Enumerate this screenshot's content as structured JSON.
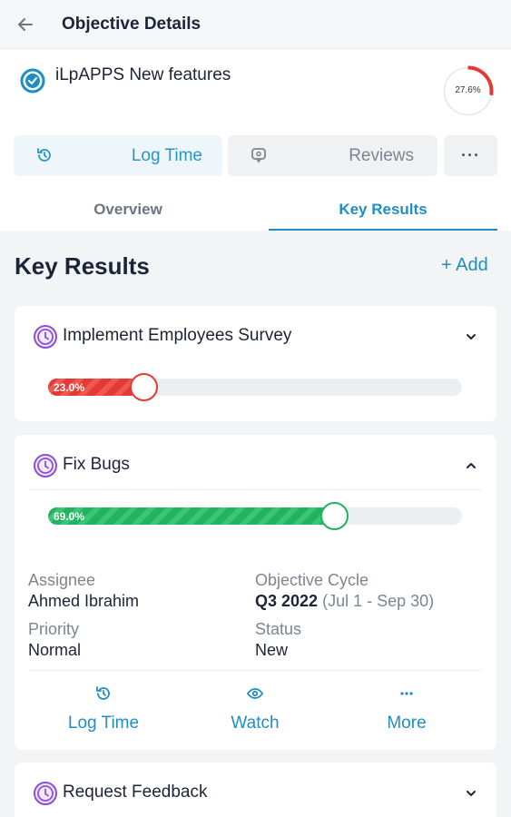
{
  "header": {
    "title": "Objective Details"
  },
  "objective": {
    "title": "iLpAPPS New features",
    "progress_label": "27.6%",
    "progress": 27.6
  },
  "actions": {
    "log_time": "Log Time",
    "reviews": "Reviews",
    "more": "···"
  },
  "tabs": {
    "overview": "Overview",
    "key_results": "Key Results"
  },
  "key_results": {
    "heading": "Key Results",
    "add_label": "+ Add",
    "items": [
      {
        "title": "Implement Employees Survey",
        "progress_label": "23.0%",
        "progress": 23.0,
        "expanded": false
      },
      {
        "title": "Fix Bugs",
        "progress_label": "69.0%",
        "progress": 69.0,
        "expanded": true,
        "assignee_label": "Assignee",
        "assignee": "Ahmed Ibrahim",
        "cycle_label": "Objective Cycle",
        "cycle": "Q3 2022",
        "cycle_range": "(Jul 1 - Sep 30)",
        "priority_label": "Priority",
        "priority": "Normal",
        "status_label": "Status",
        "status": "New",
        "actions": {
          "log_time": "Log Time",
          "watch": "Watch",
          "more": "More"
        }
      },
      {
        "title": "Request Feedback",
        "expanded": false
      }
    ]
  },
  "colors": {
    "accent": "#1f8ec0",
    "danger": "#e53935",
    "success": "#22b35e",
    "kr_icon": "#8a4fd8"
  }
}
